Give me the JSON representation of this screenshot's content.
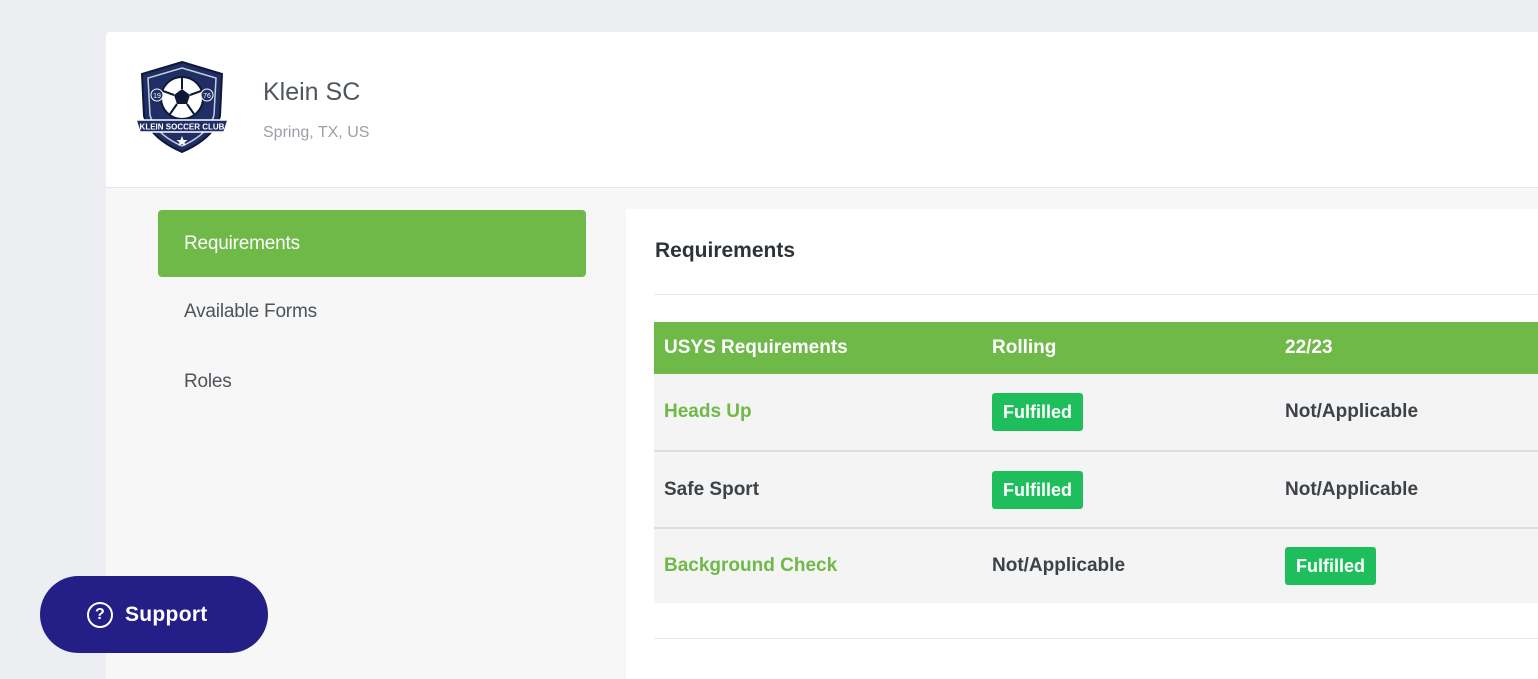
{
  "club": {
    "name": "Klein SC",
    "location": "Spring, TX, US",
    "logo_text": "KLEIN SOCCER CLUB",
    "logo_year_left": "19",
    "logo_year_right": "76"
  },
  "sidebar": {
    "items": [
      {
        "label": "Requirements",
        "active": true
      },
      {
        "label": "Available Forms",
        "active": false
      },
      {
        "label": "Roles",
        "active": false
      }
    ]
  },
  "content": {
    "title": "Requirements",
    "table": {
      "headers": [
        "USYS Requirements",
        "Rolling",
        "22/23"
      ],
      "rows": [
        {
          "name": "Heads Up",
          "link": true,
          "rolling": "Fulfilled",
          "season": "Not/Applicable"
        },
        {
          "name": "Safe Sport",
          "link": false,
          "rolling": "Fulfilled",
          "season": "Not/Applicable"
        },
        {
          "name": "Background Check",
          "link": true,
          "rolling": "Not/Applicable",
          "season": "Fulfilled"
        }
      ]
    }
  },
  "support": {
    "label": "Support",
    "icon": "?"
  },
  "colors": {
    "accent_green": "#6fb948",
    "badge_green": "#1ebe5d",
    "support_navy": "#241e87"
  }
}
